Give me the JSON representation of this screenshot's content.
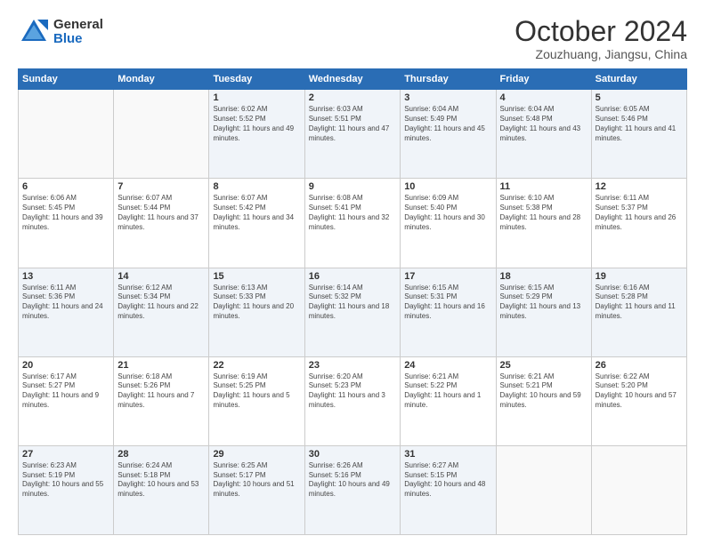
{
  "logo": {
    "general": "General",
    "blue": "Blue"
  },
  "header": {
    "month": "October 2024",
    "location": "Zouzhuang, Jiangsu, China"
  },
  "days_of_week": [
    "Sunday",
    "Monday",
    "Tuesday",
    "Wednesday",
    "Thursday",
    "Friday",
    "Saturday"
  ],
  "weeks": [
    [
      {
        "day": "",
        "info": ""
      },
      {
        "day": "",
        "info": ""
      },
      {
        "day": "1",
        "info": "Sunrise: 6:02 AM\nSunset: 5:52 PM\nDaylight: 11 hours and 49 minutes."
      },
      {
        "day": "2",
        "info": "Sunrise: 6:03 AM\nSunset: 5:51 PM\nDaylight: 11 hours and 47 minutes."
      },
      {
        "day": "3",
        "info": "Sunrise: 6:04 AM\nSunset: 5:49 PM\nDaylight: 11 hours and 45 minutes."
      },
      {
        "day": "4",
        "info": "Sunrise: 6:04 AM\nSunset: 5:48 PM\nDaylight: 11 hours and 43 minutes."
      },
      {
        "day": "5",
        "info": "Sunrise: 6:05 AM\nSunset: 5:46 PM\nDaylight: 11 hours and 41 minutes."
      }
    ],
    [
      {
        "day": "6",
        "info": "Sunrise: 6:06 AM\nSunset: 5:45 PM\nDaylight: 11 hours and 39 minutes."
      },
      {
        "day": "7",
        "info": "Sunrise: 6:07 AM\nSunset: 5:44 PM\nDaylight: 11 hours and 37 minutes."
      },
      {
        "day": "8",
        "info": "Sunrise: 6:07 AM\nSunset: 5:42 PM\nDaylight: 11 hours and 34 minutes."
      },
      {
        "day": "9",
        "info": "Sunrise: 6:08 AM\nSunset: 5:41 PM\nDaylight: 11 hours and 32 minutes."
      },
      {
        "day": "10",
        "info": "Sunrise: 6:09 AM\nSunset: 5:40 PM\nDaylight: 11 hours and 30 minutes."
      },
      {
        "day": "11",
        "info": "Sunrise: 6:10 AM\nSunset: 5:38 PM\nDaylight: 11 hours and 28 minutes."
      },
      {
        "day": "12",
        "info": "Sunrise: 6:11 AM\nSunset: 5:37 PM\nDaylight: 11 hours and 26 minutes."
      }
    ],
    [
      {
        "day": "13",
        "info": "Sunrise: 6:11 AM\nSunset: 5:36 PM\nDaylight: 11 hours and 24 minutes."
      },
      {
        "day": "14",
        "info": "Sunrise: 6:12 AM\nSunset: 5:34 PM\nDaylight: 11 hours and 22 minutes."
      },
      {
        "day": "15",
        "info": "Sunrise: 6:13 AM\nSunset: 5:33 PM\nDaylight: 11 hours and 20 minutes."
      },
      {
        "day": "16",
        "info": "Sunrise: 6:14 AM\nSunset: 5:32 PM\nDaylight: 11 hours and 18 minutes."
      },
      {
        "day": "17",
        "info": "Sunrise: 6:15 AM\nSunset: 5:31 PM\nDaylight: 11 hours and 16 minutes."
      },
      {
        "day": "18",
        "info": "Sunrise: 6:15 AM\nSunset: 5:29 PM\nDaylight: 11 hours and 13 minutes."
      },
      {
        "day": "19",
        "info": "Sunrise: 6:16 AM\nSunset: 5:28 PM\nDaylight: 11 hours and 11 minutes."
      }
    ],
    [
      {
        "day": "20",
        "info": "Sunrise: 6:17 AM\nSunset: 5:27 PM\nDaylight: 11 hours and 9 minutes."
      },
      {
        "day": "21",
        "info": "Sunrise: 6:18 AM\nSunset: 5:26 PM\nDaylight: 11 hours and 7 minutes."
      },
      {
        "day": "22",
        "info": "Sunrise: 6:19 AM\nSunset: 5:25 PM\nDaylight: 11 hours and 5 minutes."
      },
      {
        "day": "23",
        "info": "Sunrise: 6:20 AM\nSunset: 5:23 PM\nDaylight: 11 hours and 3 minutes."
      },
      {
        "day": "24",
        "info": "Sunrise: 6:21 AM\nSunset: 5:22 PM\nDaylight: 11 hours and 1 minute."
      },
      {
        "day": "25",
        "info": "Sunrise: 6:21 AM\nSunset: 5:21 PM\nDaylight: 10 hours and 59 minutes."
      },
      {
        "day": "26",
        "info": "Sunrise: 6:22 AM\nSunset: 5:20 PM\nDaylight: 10 hours and 57 minutes."
      }
    ],
    [
      {
        "day": "27",
        "info": "Sunrise: 6:23 AM\nSunset: 5:19 PM\nDaylight: 10 hours and 55 minutes."
      },
      {
        "day": "28",
        "info": "Sunrise: 6:24 AM\nSunset: 5:18 PM\nDaylight: 10 hours and 53 minutes."
      },
      {
        "day": "29",
        "info": "Sunrise: 6:25 AM\nSunset: 5:17 PM\nDaylight: 10 hours and 51 minutes."
      },
      {
        "day": "30",
        "info": "Sunrise: 6:26 AM\nSunset: 5:16 PM\nDaylight: 10 hours and 49 minutes."
      },
      {
        "day": "31",
        "info": "Sunrise: 6:27 AM\nSunset: 5:15 PM\nDaylight: 10 hours and 48 minutes."
      },
      {
        "day": "",
        "info": ""
      },
      {
        "day": "",
        "info": ""
      }
    ]
  ]
}
